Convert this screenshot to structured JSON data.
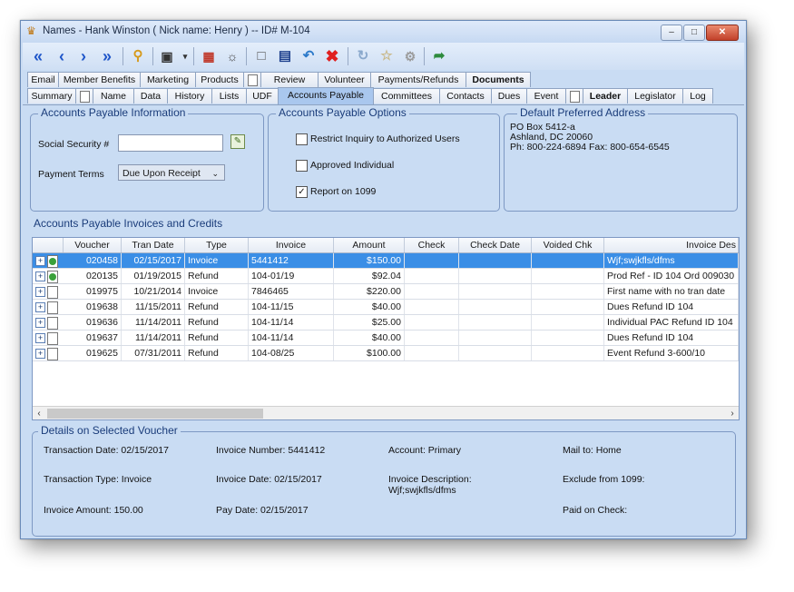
{
  "window": {
    "title": "Names - Hank Winston  ( Nick name: Henry )  -- ID# M-104"
  },
  "window_controls": {
    "minimize": "–",
    "maximize": "□",
    "close": "✕"
  },
  "toolbar": {
    "icons": [
      "first-record",
      "previous-record",
      "next-record",
      "last-record",
      "search",
      "camera",
      "print",
      "view",
      "new",
      "save",
      "undo",
      "delete",
      "refresh",
      "favorite",
      "settings",
      "export"
    ]
  },
  "tabs_row1": [
    "Email",
    "Member Benefits",
    "Marketing",
    "Products",
    "Review",
    "Volunteer",
    "Payments/Refunds",
    "Documents"
  ],
  "tabs_row2": [
    "Summary",
    "Name",
    "Data",
    "History",
    "Lists",
    "UDF",
    "Accounts Payable",
    "Committees",
    "Contacts",
    "Dues",
    "Event",
    "Leader",
    "Legislator",
    "Log"
  ],
  "ap_info": {
    "title": "Accounts Payable Information",
    "ssn_label": "Social Security #",
    "ssn_value": "",
    "terms_label": "Payment Terms",
    "terms_value": "Due Upon Receipt"
  },
  "ap_options": {
    "title": "Accounts Payable Options",
    "restrict_label": "Restrict Inquiry to Authorized Users",
    "restrict_checked": false,
    "approved_label": "Approved Individual",
    "approved_checked": false,
    "report_label": "Report on 1099",
    "report_checked": true
  },
  "address": {
    "title": "Default Preferred Address",
    "line1": "PO Box 5412-a",
    "line2": "Ashland, DC  20060",
    "line3": "Ph: 800-224-6894  Fax: 800-654-6545"
  },
  "invoices": {
    "title": "Accounts Payable Invoices and Credits",
    "columns": [
      "Voucher",
      "Tran Date",
      "Type",
      "Invoice",
      "Amount",
      "Check",
      "Check Date",
      "Voided Chk",
      "Invoice Des"
    ],
    "rows": [
      {
        "voucher": "020458",
        "date": "02/15/2017",
        "type": "Invoice",
        "invoice": "5441412",
        "amount": "$150.00",
        "check": "",
        "check_date": "",
        "voided": "",
        "desc": "Wjf;swjkfls/dfms",
        "icon": "green"
      },
      {
        "voucher": "020135",
        "date": "01/19/2015",
        "type": "Refund",
        "invoice": "104-01/19",
        "amount": "$92.04",
        "check": "",
        "check_date": "",
        "voided": "",
        "desc": "Prod Ref - ID 104 Ord 009030",
        "icon": "green"
      },
      {
        "voucher": "019975",
        "date": "10/21/2014",
        "type": "Invoice",
        "invoice": "7846465",
        "amount": "$220.00",
        "check": "",
        "check_date": "",
        "voided": "",
        "desc": "First name with no tran date",
        "icon": "doc"
      },
      {
        "voucher": "019638",
        "date": "11/15/2011",
        "type": "Refund",
        "invoice": "104-11/15",
        "amount": "$40.00",
        "check": "",
        "check_date": "",
        "voided": "",
        "desc": "Dues Refund ID 104",
        "icon": "doc"
      },
      {
        "voucher": "019636",
        "date": "11/14/2011",
        "type": "Refund",
        "invoice": "104-11/14",
        "amount": "$25.00",
        "check": "",
        "check_date": "",
        "voided": "",
        "desc": "Individual PAC Refund ID 104",
        "icon": "doc"
      },
      {
        "voucher": "019637",
        "date": "11/14/2011",
        "type": "Refund",
        "invoice": "104-11/14",
        "amount": "$40.00",
        "check": "",
        "check_date": "",
        "voided": "",
        "desc": "Dues Refund ID 104",
        "icon": "doc"
      },
      {
        "voucher": "019625",
        "date": "07/31/2011",
        "type": "Refund",
        "invoice": "104-08/25",
        "amount": "$100.00",
        "check": "",
        "check_date": "",
        "voided": "",
        "desc": "Event Refund 3-600/10",
        "icon": "doc"
      }
    ]
  },
  "details": {
    "title": "Details on Selected Voucher",
    "transaction_date": "Transaction Date:  02/15/2017",
    "transaction_type": "Transaction Type:  Invoice",
    "invoice_amount": "Invoice Amount:  150.00",
    "invoice_number": "Invoice Number:  5441412",
    "invoice_date": "Invoice Date:  02/15/2017",
    "pay_date": "Pay Date:  02/15/2017",
    "account": "Account:  Primary",
    "invoice_description_label": "Invoice Description:",
    "invoice_description_value": "Wjf;swjkfls/dfms",
    "mail_to": "Mail to:  Home",
    "exclude_1099": "Exclude from 1099:",
    "paid_on_check": "Paid on Check:"
  },
  "colors": {
    "selected_row": "#3a8ee6",
    "panel_bg": "#c9dcf3",
    "group_title": "#1a3c7a"
  }
}
